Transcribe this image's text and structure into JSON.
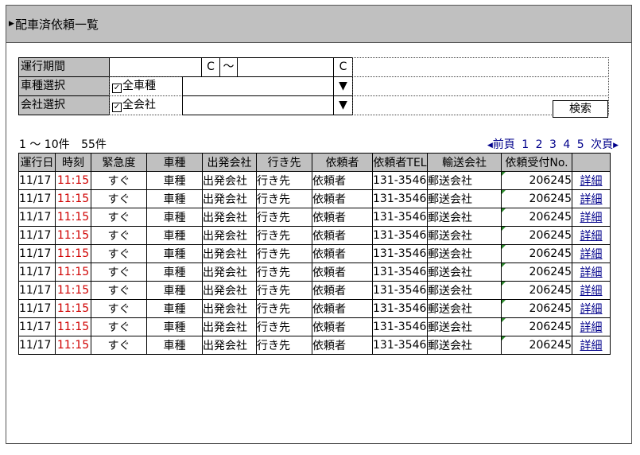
{
  "title": "配車済依頼一覧",
  "filter": {
    "period_label": "運行期間",
    "period_start_value": "",
    "calendar_button": "C",
    "tilde": "〜",
    "period_end_value": "",
    "vehicle_label": "車種選択",
    "vehicle_all_label": "全車種",
    "company_label": "会社選択",
    "company_all_label": "全会社",
    "dropdown_arrow": "▼",
    "search_button": "検索"
  },
  "summary": {
    "range": "1 〜 10件",
    "total": "55件"
  },
  "pager": {
    "prev": "前頁",
    "pages": [
      "1",
      "2",
      "3",
      "4",
      "5"
    ],
    "next": "次頁"
  },
  "table": {
    "headers": [
      "運行日",
      "時刻",
      "緊急度",
      "車種",
      "出発会社",
      "行き先",
      "依頼者",
      "依頼者TEL",
      "輸送会社",
      "依頼受付No.",
      ""
    ],
    "rows": [
      [
        "11/17",
        "11:15",
        "すぐ",
        "車種",
        "出発会社",
        "行き先",
        "依頼者",
        "131-3546",
        "郵送会社",
        "206245",
        "詳細"
      ],
      [
        "11/17",
        "11:15",
        "すぐ",
        "車種",
        "出発会社",
        "行き先",
        "依頼者",
        "131-3546",
        "郵送会社",
        "206245",
        "詳細"
      ],
      [
        "11/17",
        "11:15",
        "すぐ",
        "車種",
        "出発会社",
        "行き先",
        "依頼者",
        "131-3546",
        "郵送会社",
        "206245",
        "詳細"
      ],
      [
        "11/17",
        "11:15",
        "すぐ",
        "車種",
        "出発会社",
        "行き先",
        "依頼者",
        "131-3546",
        "郵送会社",
        "206245",
        "詳細"
      ],
      [
        "11/17",
        "11:15",
        "すぐ",
        "車種",
        "出発会社",
        "行き先",
        "依頼者",
        "131-3546",
        "郵送会社",
        "206245",
        "詳細"
      ],
      [
        "11/17",
        "11:15",
        "すぐ",
        "車種",
        "出発会社",
        "行き先",
        "依頼者",
        "131-3546",
        "郵送会社",
        "206245",
        "詳細"
      ],
      [
        "11/17",
        "11:15",
        "すぐ",
        "車種",
        "出発会社",
        "行き先",
        "依頼者",
        "131-3546",
        "郵送会社",
        "206245",
        "詳細"
      ],
      [
        "11/17",
        "11:15",
        "すぐ",
        "車種",
        "出発会社",
        "行き先",
        "依頼者",
        "131-3546",
        "郵送会社",
        "206245",
        "詳細"
      ],
      [
        "11/17",
        "11:15",
        "すぐ",
        "車種",
        "出発会社",
        "行き先",
        "依頼者",
        "131-3546",
        "郵送会社",
        "206245",
        "詳細"
      ],
      [
        "11/17",
        "11:15",
        "すぐ",
        "車種",
        "出発会社",
        "行き先",
        "依頼者",
        "131-3546",
        "郵送会社",
        "206245",
        "詳細"
      ]
    ]
  },
  "colors": {
    "header_bg": "#c0c0c0",
    "time_red": "#d00000",
    "link_blue": "#00008b",
    "mark_green": "#2e8b2e"
  }
}
